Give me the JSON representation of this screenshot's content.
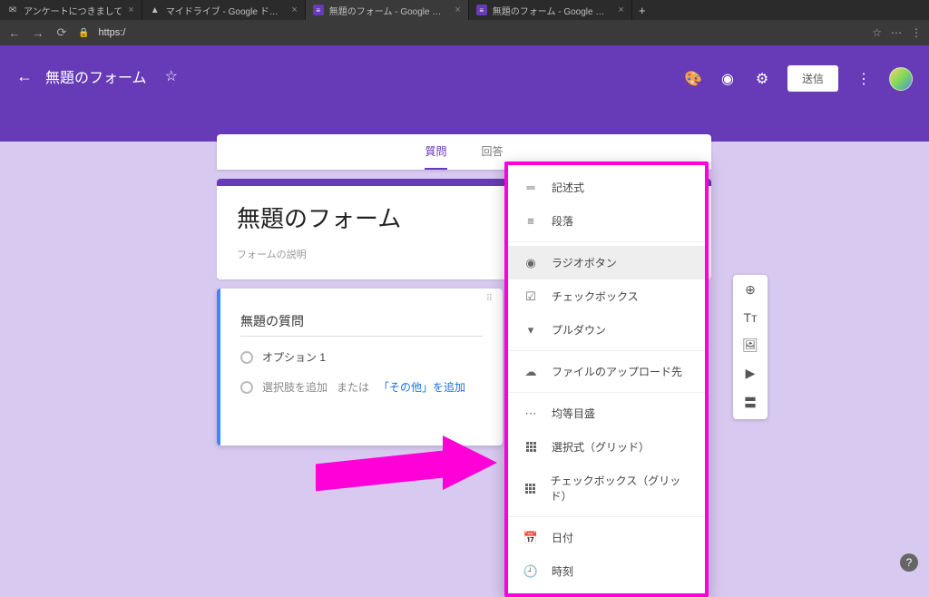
{
  "browser": {
    "tabs": [
      {
        "title": "アンケートにつきまして"
      },
      {
        "title": "マイドライブ - Google ドライブ"
      },
      {
        "title": "無題のフォーム - Google フォー"
      },
      {
        "title": "無題のフォーム - Google フォー"
      }
    ],
    "url": "https:/"
  },
  "header": {
    "form_title": "無題のフォーム",
    "send": "送信"
  },
  "tabs": {
    "questions": "質問",
    "responses": "回答"
  },
  "form": {
    "title": "無題のフォーム",
    "description_placeholder": "フォームの説明"
  },
  "question": {
    "title": "無題の質問",
    "option1": "オプション 1",
    "add_option": "選択肢を追加",
    "or": "または",
    "add_other": "「その他」を追加"
  },
  "menu": {
    "short_answer": "記述式",
    "paragraph": "段落",
    "radio": "ラジオボタン",
    "checkbox": "チェックボックス",
    "dropdown": "プルダウン",
    "file": "ファイルのアップロード先",
    "scale": "均等目盛",
    "grid_radio": "選択式（グリッド）",
    "grid_check": "チェックボックス（グリッド）",
    "date": "日付",
    "time": "時刻"
  }
}
